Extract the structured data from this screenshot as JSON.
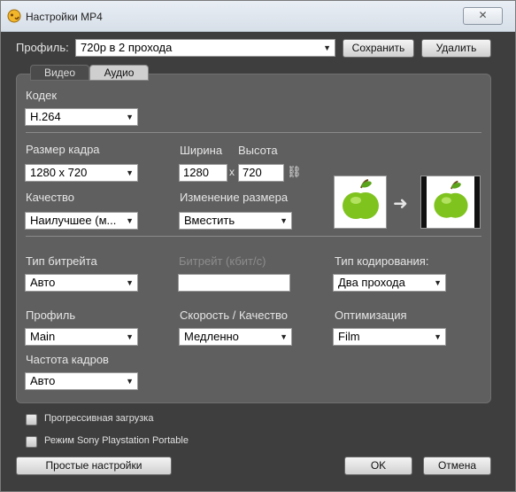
{
  "window": {
    "title": "Настройки MP4"
  },
  "profile_row": {
    "label": "Профиль:",
    "value": "720p в 2 прохода",
    "save_label": "Сохранить",
    "delete_label": "Удалить"
  },
  "tabs": [
    {
      "label": "Видео"
    },
    {
      "label": "Аудио"
    }
  ],
  "codec": {
    "label": "Кодек",
    "value": "H.264"
  },
  "frame_size": {
    "label": "Размер кадра",
    "value": "1280 x 720"
  },
  "width": {
    "label": "Ширина",
    "value": "1280"
  },
  "height": {
    "label": "Высота",
    "value": "720"
  },
  "times_symbol": "x",
  "quality": {
    "label": "Качество",
    "value": "Наилучшее (м..."
  },
  "resize": {
    "label": "Изменение размера",
    "value": "Вместить"
  },
  "bitrate_type": {
    "label": "Тип битрейта",
    "value": "Авто"
  },
  "bitrate": {
    "label": "Битрейт (кбит/с)",
    "value": ""
  },
  "encoding_type": {
    "label": "Тип кодирования:",
    "value": "Два прохода"
  },
  "profile": {
    "label": "Профиль",
    "value": "Main"
  },
  "speed_quality": {
    "label": "Скорость / Качество",
    "value": "Медленно"
  },
  "optimization": {
    "label": "Оптимизация",
    "value": "Film"
  },
  "framerate": {
    "label": "Частота кадров",
    "value": "Авто"
  },
  "checkboxes": {
    "progressive": "Прогрессивная загрузка",
    "psp": "Режим Sony Playstation Portable"
  },
  "bottom": {
    "simple_settings": "Простые настройки",
    "ok": "OK",
    "cancel": "Отмена"
  },
  "colors": {
    "panel_bg": "#5f5f5f",
    "window_bg": "#3e3e3e",
    "apple_green": "#7fc31f"
  }
}
